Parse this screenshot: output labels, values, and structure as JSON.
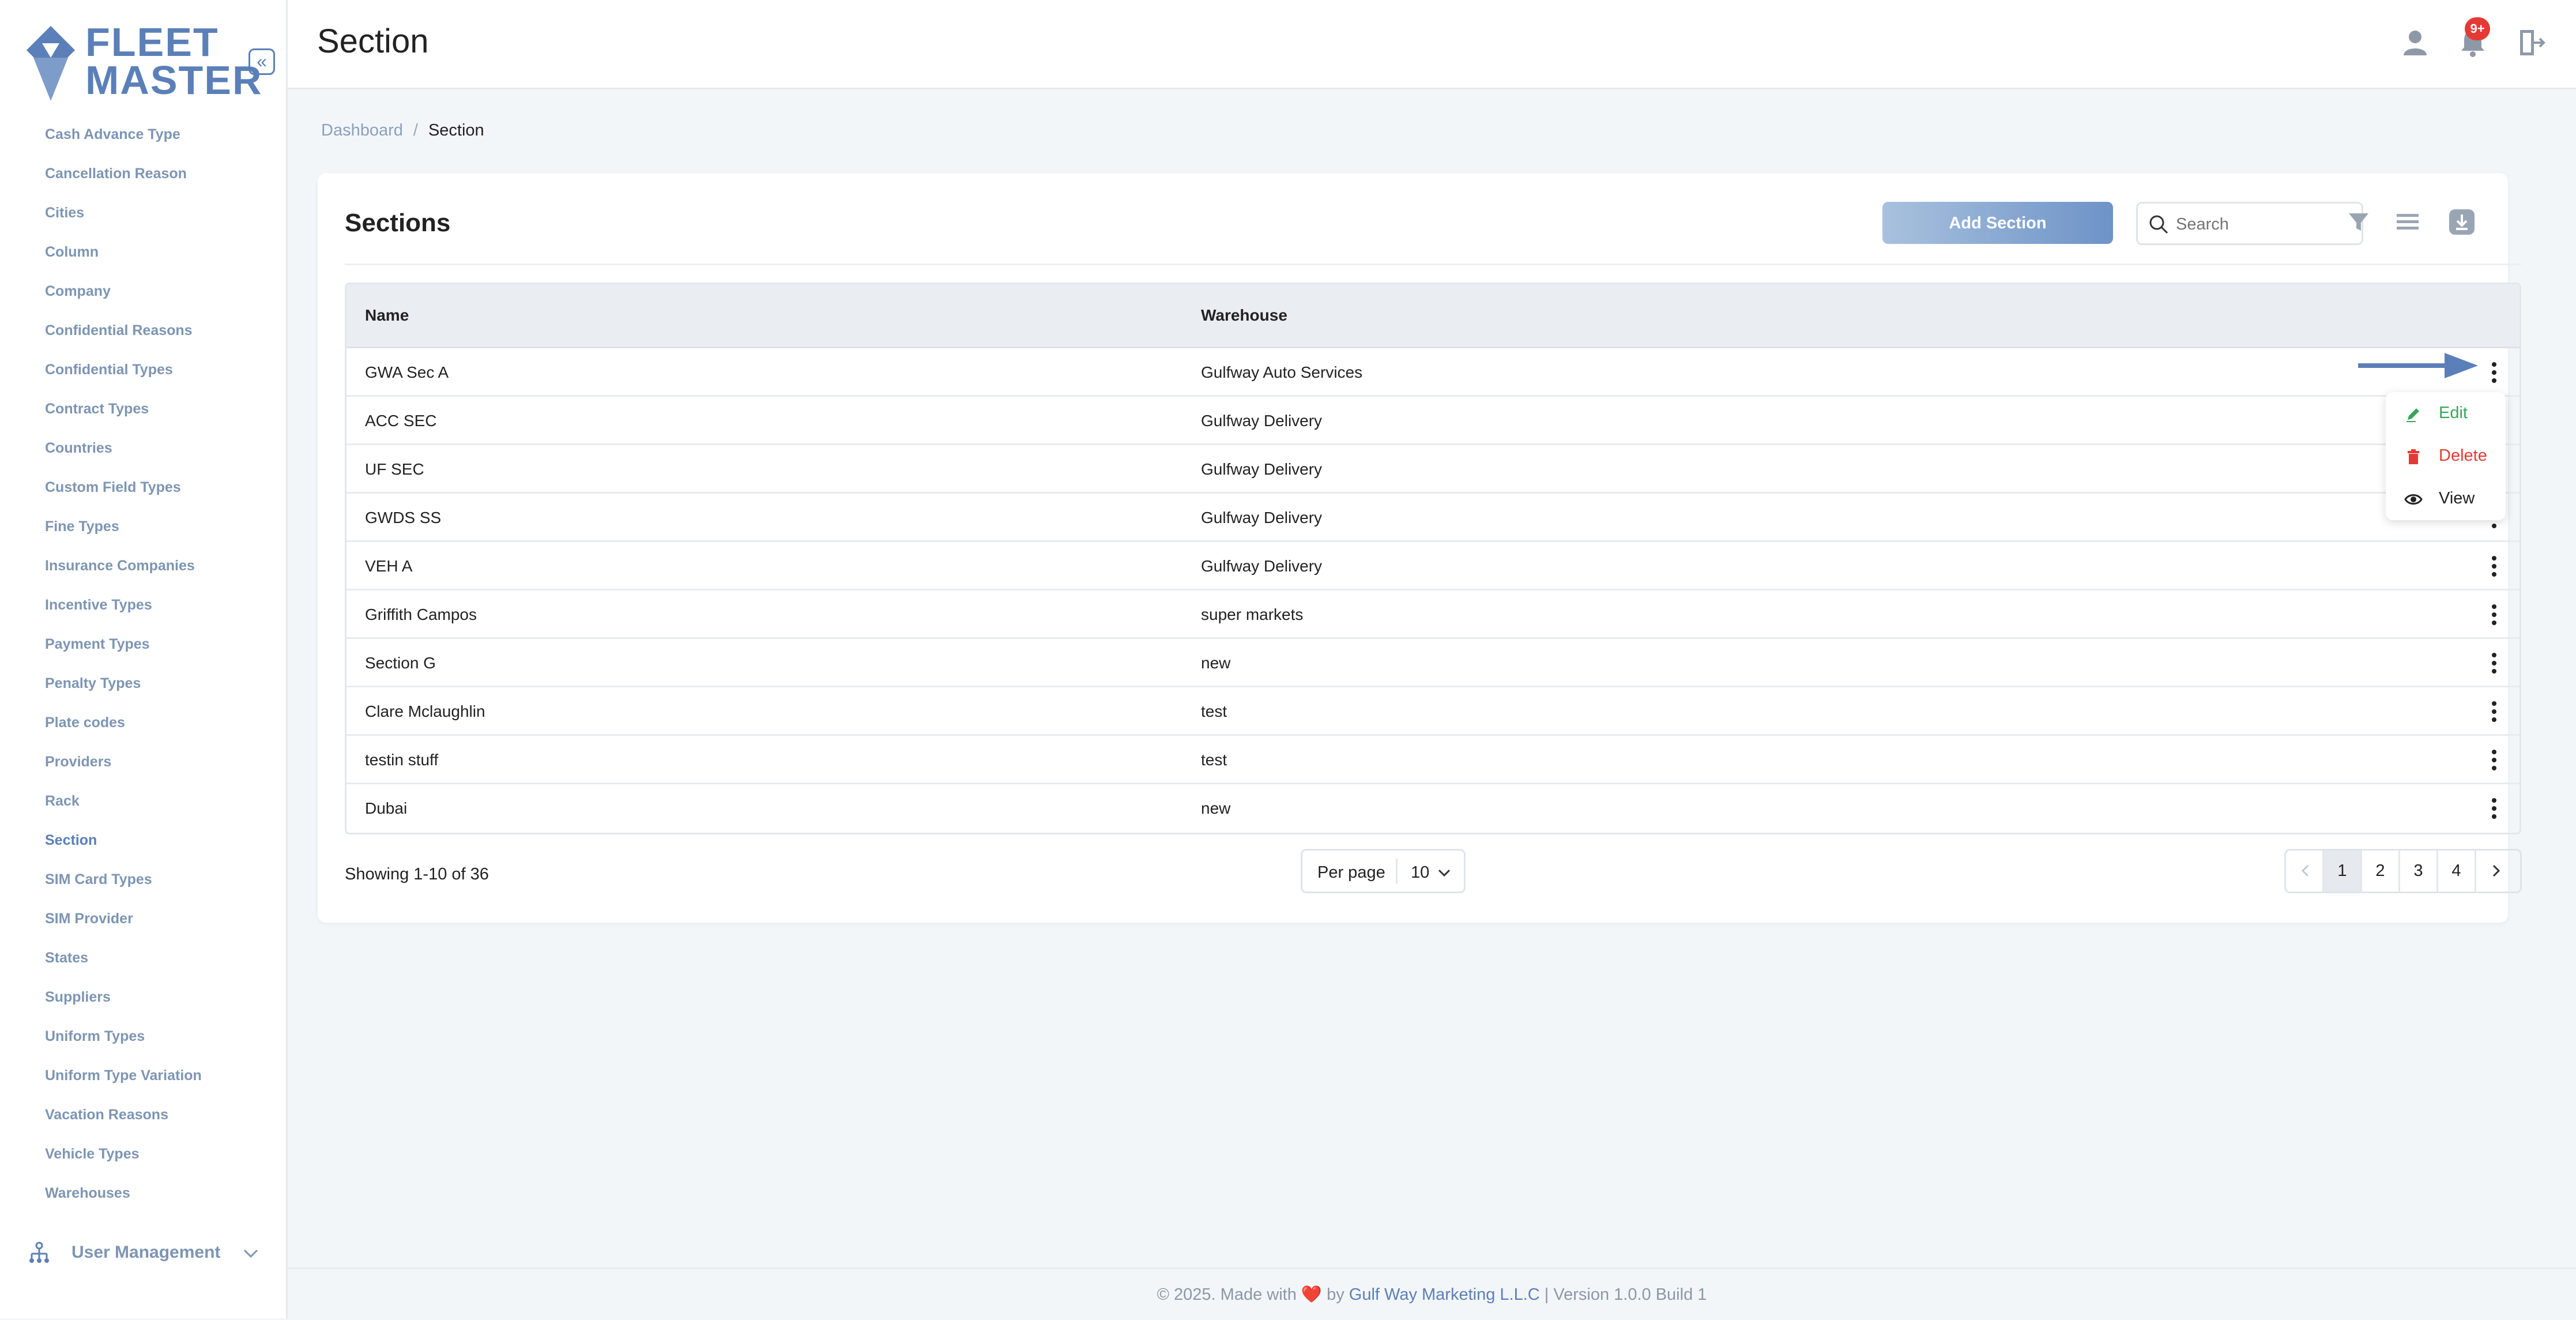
{
  "brand": {
    "logo_text_1": "FLEET",
    "logo_text_2": "MASTER",
    "collapse_glyph": "«"
  },
  "sidebar": {
    "items": [
      {
        "label": "Cash Advance Type"
      },
      {
        "label": "Cancellation Reason"
      },
      {
        "label": "Cities"
      },
      {
        "label": "Column"
      },
      {
        "label": "Company"
      },
      {
        "label": "Confidential Reasons"
      },
      {
        "label": "Confidential Types"
      },
      {
        "label": "Contract Types"
      },
      {
        "label": "Countries"
      },
      {
        "label": "Custom Field Types"
      },
      {
        "label": "Fine Types"
      },
      {
        "label": "Insurance Companies"
      },
      {
        "label": "Incentive Types"
      },
      {
        "label": "Payment Types"
      },
      {
        "label": "Penalty Types"
      },
      {
        "label": "Plate codes"
      },
      {
        "label": "Providers"
      },
      {
        "label": "Rack"
      },
      {
        "label": "Section",
        "active": true
      },
      {
        "label": "SIM Card Types"
      },
      {
        "label": "SIM Provider"
      },
      {
        "label": "States"
      },
      {
        "label": "Suppliers"
      },
      {
        "label": "Uniform Types"
      },
      {
        "label": "Uniform Type Variation"
      },
      {
        "label": "Vacation Reasons"
      },
      {
        "label": "Vehicle Types"
      },
      {
        "label": "Warehouses"
      }
    ],
    "user_management": "User Management"
  },
  "header": {
    "title": "Section",
    "notification_badge": "9+"
  },
  "breadcrumb": {
    "home": "Dashboard",
    "separator": "/",
    "current": "Section"
  },
  "card": {
    "title": "Sections",
    "add_button": "Add Section",
    "search": {
      "placeholder": "Search",
      "value": ""
    }
  },
  "table": {
    "columns": {
      "name": "Name",
      "warehouse": "Warehouse"
    },
    "rows": [
      {
        "name": "GWA Sec A",
        "warehouse": "Gulfway Auto Services"
      },
      {
        "name": "ACC SEC",
        "warehouse": "Gulfway Delivery"
      },
      {
        "name": "UF SEC",
        "warehouse": "Gulfway Delivery"
      },
      {
        "name": "GWDS SS",
        "warehouse": "Gulfway Delivery"
      },
      {
        "name": "VEH A",
        "warehouse": "Gulfway Delivery"
      },
      {
        "name": "Griffith Campos",
        "warehouse": "super markets"
      },
      {
        "name": "Section G",
        "warehouse": "new"
      },
      {
        "name": "Clare Mclaughlin",
        "warehouse": "test"
      },
      {
        "name": "testin stuff",
        "warehouse": "test"
      },
      {
        "name": "Dubai",
        "warehouse": "new"
      }
    ]
  },
  "row_menu": {
    "edit": "Edit",
    "delete": "Delete",
    "view": "View"
  },
  "pagination": {
    "showing": "Showing 1-10 of 36",
    "per_page_label": "Per page",
    "per_page_value": "10",
    "pages": [
      "1",
      "2",
      "3",
      "4"
    ],
    "current_page": "1"
  },
  "footer": {
    "prefix": "© 2025. Made with",
    "heart": "❤️",
    "by": "by",
    "company": "Gulf Way Marketing L.L.C",
    "version": "| Version 1.0.0 Build 1"
  },
  "colors": {
    "accent": "#5b7fb8",
    "danger": "#e53935",
    "success": "#3aa55a"
  }
}
